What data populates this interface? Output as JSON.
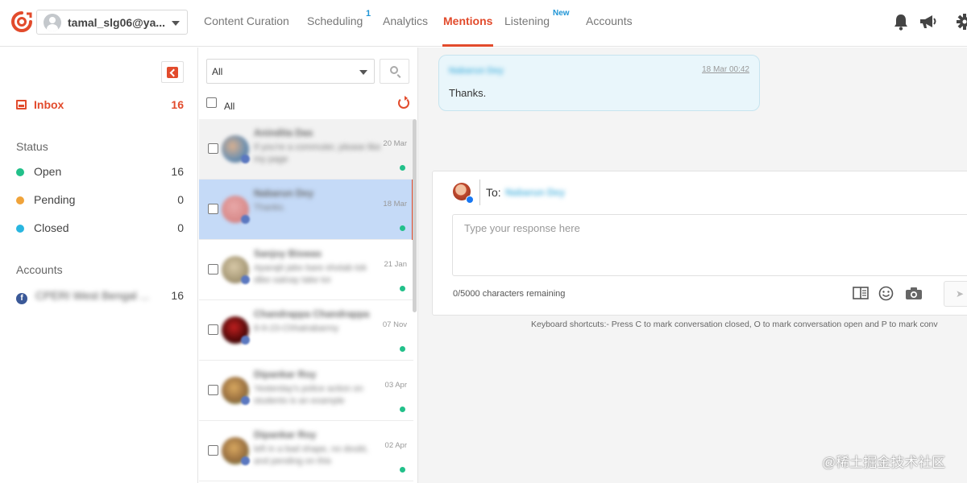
{
  "header": {
    "account": "tamal_slg06@ya...",
    "nav": [
      {
        "label": "Content Curation"
      },
      {
        "label": "Scheduling",
        "badge": "1"
      },
      {
        "label": "Analytics"
      },
      {
        "label": "Mentions",
        "active": true
      },
      {
        "label": "Listening",
        "badge": "New"
      },
      {
        "label": "Accounts"
      }
    ],
    "icons": [
      "bell-icon",
      "megaphone-icon",
      "gear-icon"
    ],
    "accent_color": "#e24b2c"
  },
  "sidebar": {
    "inbox": {
      "label": "Inbox",
      "count": "16"
    },
    "status_heading": "Status",
    "statuses": [
      {
        "label": "Open",
        "count": "16",
        "color": "#22c08a"
      },
      {
        "label": "Pending",
        "count": "0",
        "color": "#f0a33a"
      },
      {
        "label": "Closed",
        "count": "0",
        "color": "#29b6e0"
      }
    ],
    "accounts_heading": "Accounts",
    "account": {
      "name": "CPERI West Bengal ...",
      "count": "16"
    }
  },
  "list": {
    "filter_value": "All",
    "select_all_label": "All",
    "conversations": [
      {
        "name": "Anindita Das",
        "preview": "If you're a commuter, please like my page",
        "date": "20 Mar"
      },
      {
        "name": "Nabarun Dey",
        "preview": "Thanks.",
        "date": "18 Mar"
      },
      {
        "name": "Sanjoy Biswas",
        "preview": "Aparajit jabo bare shotab tok dibo satnay take tor",
        "date": "21 Jan"
      },
      {
        "name": "Chandrappa Chandrappa",
        "preview": "8-9-23-Chhatrabarmy",
        "date": "07 Nov"
      },
      {
        "name": "Dipankar Roy",
        "preview": "Yesterday's police action on students is an example",
        "date": "03 Apr"
      },
      {
        "name": "Dipankar Roy",
        "preview": "left in a bad shape, no doubt, and pending on this",
        "date": "02 Apr"
      }
    ]
  },
  "thread": {
    "message": {
      "author": "Nabarun Dey",
      "time": "18 Mar 00:42",
      "text": "Thanks."
    },
    "reply": {
      "to_label": "To:",
      "to_name": "Nabarun Dey",
      "placeholder": "Type your response here",
      "chars_remaining": "0/5000 characters remaining"
    },
    "shortcuts": "Keyboard shortcuts:- Press C to mark conversation closed, O to mark conversation open and P to mark conv"
  },
  "watermark": "@稀土掘金技术社区"
}
